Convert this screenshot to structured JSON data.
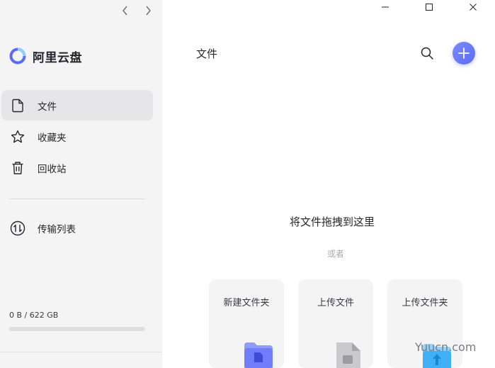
{
  "app": {
    "brand_name": "阿里云盘",
    "brand_color": "#5c6bf5"
  },
  "nav_arrows": {
    "back_icon": "chevron-left-icon",
    "forward_icon": "chevron-right-icon"
  },
  "sidebar": {
    "items": [
      {
        "label": "文件",
        "icon": "file-icon",
        "active": true
      },
      {
        "label": "收藏夹",
        "icon": "star-icon",
        "active": false
      },
      {
        "label": "回收站",
        "icon": "trash-icon",
        "active": false
      },
      {
        "label": "传输列表",
        "icon": "transfer-icon",
        "active": false
      }
    ],
    "storage": {
      "text": "0 B / 622 GB",
      "used_fraction": 0
    }
  },
  "window_controls": {
    "minimize_icon": "minimize-icon",
    "maximize_icon": "maximize-icon",
    "close_icon": "close-icon"
  },
  "main": {
    "title": "文件",
    "search_icon": "search-icon",
    "add_icon": "plus-icon",
    "drop_hint": "将文件拖拽到这里",
    "or_text": "或者",
    "cards": [
      {
        "label": "新建文件夹",
        "icon": "new-folder-icon"
      },
      {
        "label": "上传文件",
        "icon": "upload-file-icon"
      },
      {
        "label": "上传文件夹",
        "icon": "upload-folder-icon"
      }
    ]
  },
  "watermark": "Yuucn.com"
}
